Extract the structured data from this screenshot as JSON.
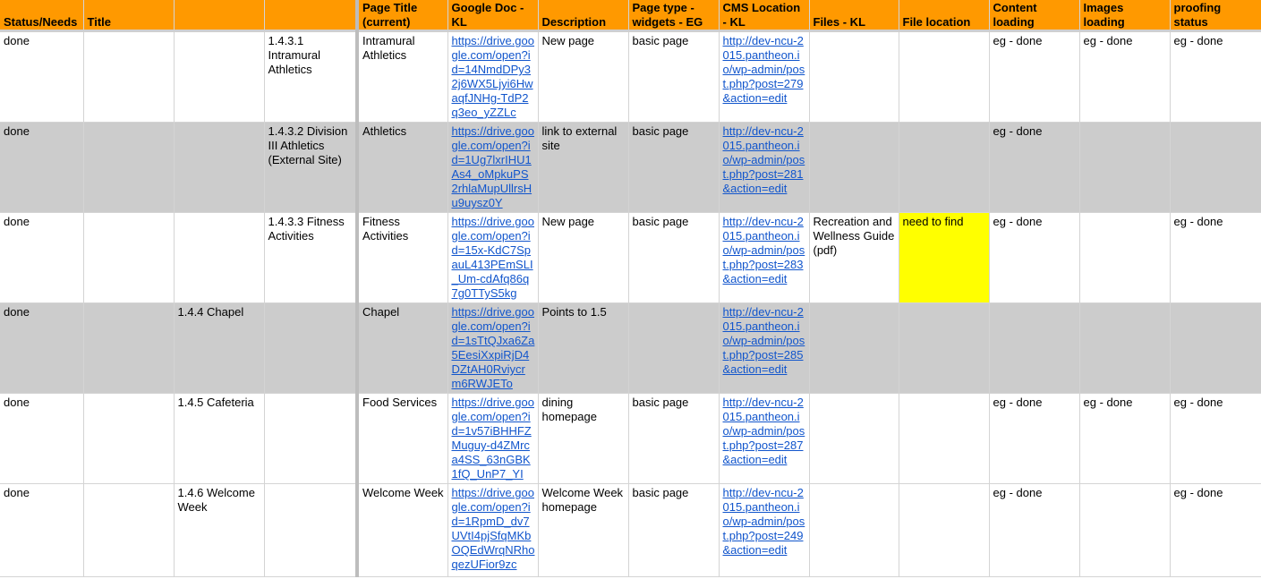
{
  "headers": [
    "Status/Needs",
    "Title",
    "",
    "",
    "Page Title (current)",
    "Google Doc - KL",
    "Description",
    "Page type - widgets - EG",
    "CMS Location - KL",
    "Files - KL",
    "File location",
    "Content loading",
    "Images loading",
    "proofing status"
  ],
  "rows": [
    {
      "grey": false,
      "cells": [
        "done",
        "",
        "",
        "1.4.3.1 Intramural Athletics",
        "Intramural Athletics",
        "https://drive.google.com/open?id=14NmdDPy32j6WX5Ljyi6HwaqfJNHg-TdP2q3eo_yZZLc",
        "New page",
        "basic page",
        "http://dev-ncu-2015.pantheon.io/wp-admin/post.php?post=279&action=edit",
        "",
        "",
        "eg - done",
        "eg - done",
        "eg - done"
      ]
    },
    {
      "grey": true,
      "cells": [
        "done",
        "",
        "",
        "1.4.3.2 Division III Athletics (External Site)",
        "Athletics",
        "https://drive.google.com/open?id=1Ug7lxrIHU1As4_oMpkuPS2rhlaMupUllrsHu9uysz0Y",
        "link to external site",
        "basic page",
        "http://dev-ncu-2015.pantheon.io/wp-admin/post.php?post=281&action=edit",
        "",
        "",
        "eg - done",
        "",
        ""
      ]
    },
    {
      "grey": false,
      "cells": [
        "done",
        "",
        "",
        "1.4.3.3 Fitness Activities",
        "Fitness Activities",
        "https://drive.google.com/open?id=15x-KdC7SpauL413PEmSLI_Um-cdAfq86q7g0TTyS5kg",
        "New page",
        "basic page",
        "http://dev-ncu-2015.pantheon.io/wp-admin/post.php?post=283&action=edit",
        "Recreation and Wellness Guide (pdf)",
        "need to find",
        "eg - done",
        "",
        "eg - done"
      ]
    },
    {
      "grey": true,
      "cells": [
        "done",
        "",
        "1.4.4 Chapel",
        "",
        "Chapel",
        "https://drive.google.com/open?id=1sTtQJxa6Za5EesiXxpiRjD4DZtAH0Rviycrm6RWJETo",
        "Points to 1.5",
        "",
        "http://dev-ncu-2015.pantheon.io/wp-admin/post.php?post=285&action=edit",
        "",
        "",
        "",
        "",
        ""
      ]
    },
    {
      "grey": false,
      "cells": [
        "done",
        "",
        "1.4.5 Cafeteria",
        "",
        "Food Services",
        "https://drive.google.com/open?id=1v57iBHHFZMuguy-d4ZMrca4SS_63nGBK1fQ_UnP7_YI",
        "dining homepage",
        "basic page",
        "http://dev-ncu-2015.pantheon.io/wp-admin/post.php?post=287&action=edit",
        "",
        "",
        "eg - done",
        "eg - done",
        "eg - done"
      ]
    },
    {
      "grey": false,
      "cells": [
        "done",
        "",
        "1.4.6 Welcome Week",
        "",
        "Welcome Week",
        "https://drive.google.com/open?id=1RpmD_dv7UVtI4pjSfqMKbOQEdWrqNRhoqezUFior9zc",
        "Welcome Week homepage",
        "basic page",
        "http://dev-ncu-2015.pantheon.io/wp-admin/post.php?post=249&action=edit",
        "",
        "",
        "eg - done",
        "",
        "eg - done"
      ]
    }
  ],
  "highlight_color": "#ffff00",
  "header_color": "#ff9900",
  "grey_row_color": "#cccccc",
  "link_color": "#1155cc"
}
